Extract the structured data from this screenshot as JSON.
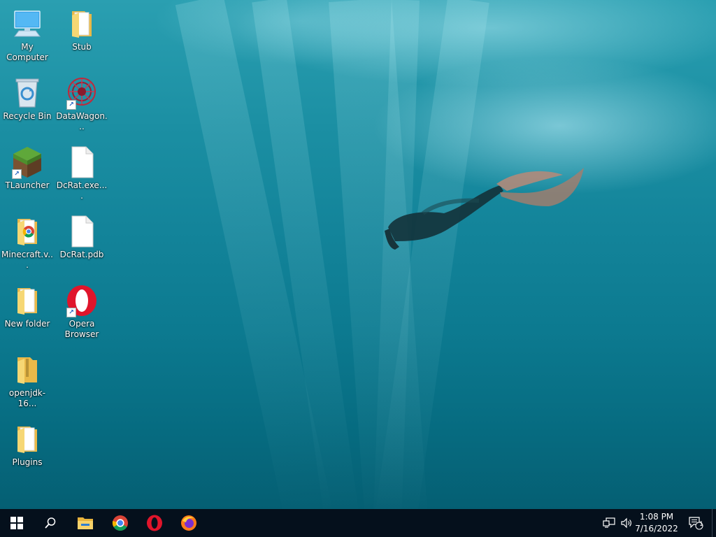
{
  "desktop": {
    "icons": [
      {
        "label": "My Computer",
        "icon": "computer-icon"
      },
      {
        "label": "Stub",
        "icon": "folder-icon"
      },
      {
        "label": "Recycle Bin",
        "icon": "recycle-bin-icon"
      },
      {
        "label": "DataWagon...",
        "icon": "datawagon-icon",
        "shortcut": true
      },
      {
        "label": "TLauncher",
        "icon": "minecraft-grass-block-icon",
        "shortcut": true
      },
      {
        "label": "DcRat.exe....",
        "icon": "blank-file-icon"
      },
      {
        "label": "Minecraft.v...",
        "icon": "chrome-folder-icon"
      },
      {
        "label": "DcRat.pdb",
        "icon": "blank-file-icon"
      },
      {
        "label": "New folder",
        "icon": "folder-icon"
      },
      {
        "label": "Opera Browser",
        "icon": "opera-icon",
        "shortcut": true
      },
      {
        "label": "openjdk-16...",
        "icon": "zip-folder-icon"
      },
      {
        "label": "Plugins",
        "icon": "folder-icon"
      }
    ]
  },
  "taskbar": {
    "start": "windows-start-icon",
    "search": "search-icon",
    "pinned": [
      "file-explorer-icon",
      "chrome-icon",
      "opera-icon",
      "firefox-icon"
    ],
    "tray": [
      "network-icon",
      "volume-icon"
    ],
    "time": "1:08 PM",
    "date": "7/16/2022",
    "notification_count": "1"
  },
  "colors": {
    "taskbar_bg": "#05101c",
    "water_top": "#2a9fb1",
    "water_bottom": "#055f73",
    "opera_red": "#e0152b",
    "folder_yellow": "#f3c94e"
  }
}
